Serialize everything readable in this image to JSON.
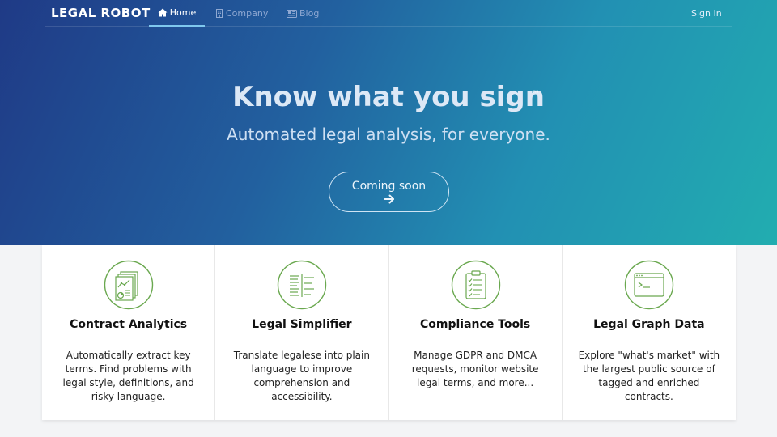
{
  "navbar": {
    "logo": "LEGAL ROBOT",
    "items": [
      {
        "label": "Home",
        "icon": "home-icon"
      },
      {
        "label": "Company",
        "icon": "building-icon"
      },
      {
        "label": "Blog",
        "icon": "newspaper-icon"
      }
    ],
    "sign_in": "Sign In"
  },
  "hero": {
    "title": "Know what you sign",
    "trademark": "™",
    "subtitle": "Automated legal analysis, for everyone.",
    "cta_label": "Coming soon",
    "cta_icon": "arrow-right-icon"
  },
  "colors": {
    "icon_green": "#6aa84f",
    "gradient_start": "#1f3a86",
    "gradient_end": "#22adb0"
  },
  "features": [
    {
      "title": "Contract Analytics",
      "icon": "analytics-document-icon",
      "desc_lines": [
        "Automatically extract key",
        "terms. Find problems with",
        "legal style, definitions, and",
        "risky language."
      ]
    },
    {
      "title": "Legal Simplifier",
      "icon": "simplify-text-icon",
      "desc_lines": [
        "Translate legalese into plain",
        "language to improve",
        "comprehension and",
        "accessibility."
      ]
    },
    {
      "title": "Compliance Tools",
      "icon": "clipboard-checklist-icon",
      "desc_lines": [
        "Manage GDPR and DMCA",
        "requests, monitor website",
        "legal terms, and more..."
      ]
    },
    {
      "title": "Legal Graph Data",
      "icon": "terminal-window-icon",
      "desc_lines": [
        "Explore \"what's market\" with",
        "the largest public source of",
        "tagged and enriched",
        "contracts."
      ]
    }
  ]
}
